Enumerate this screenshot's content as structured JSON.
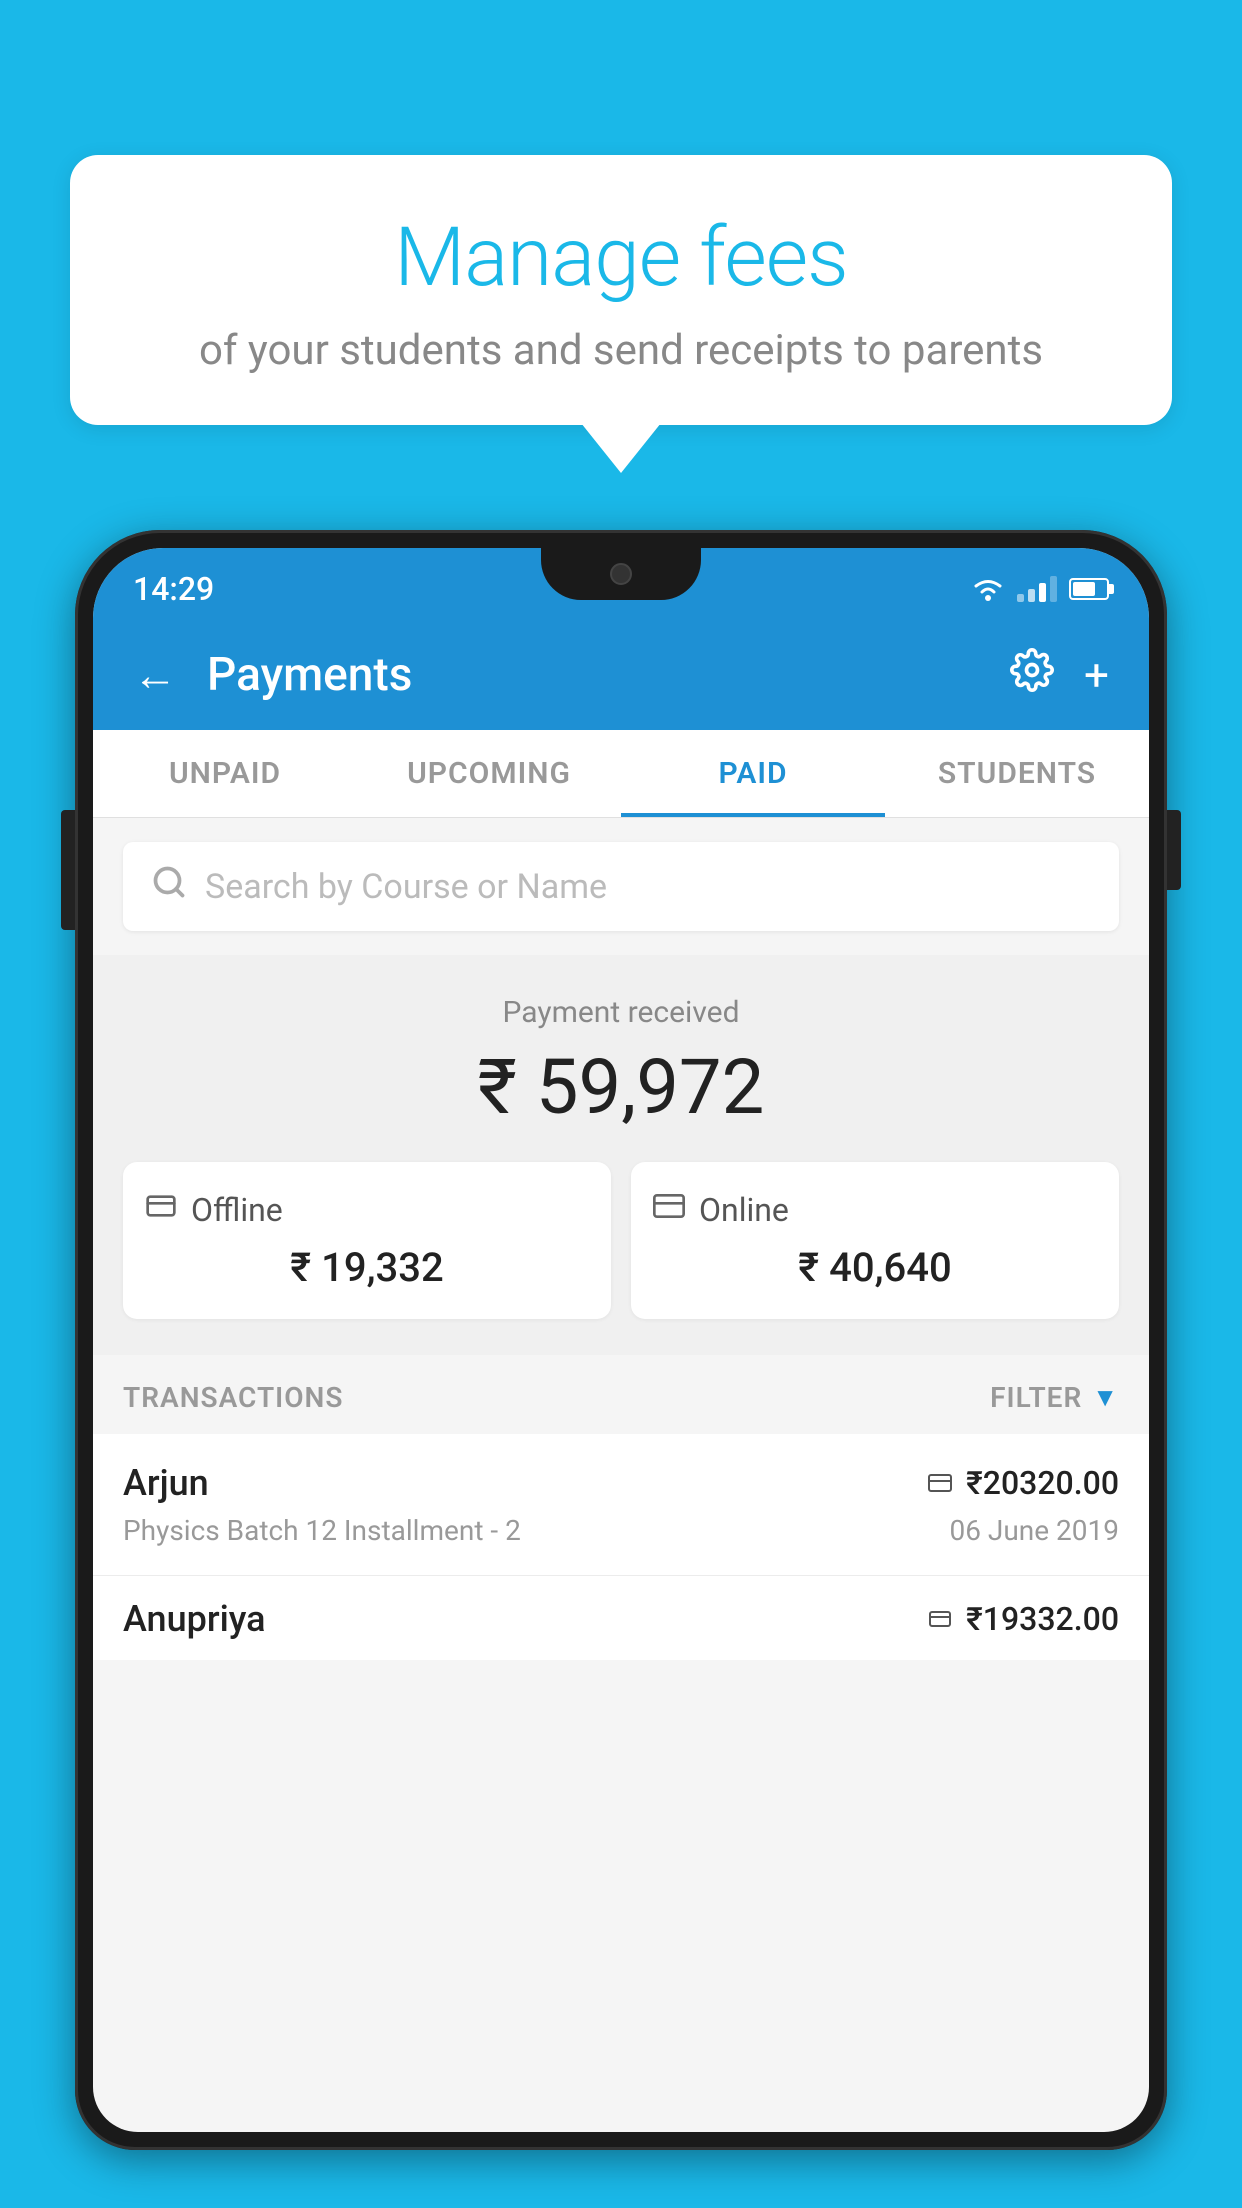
{
  "background_color": "#1ab8e8",
  "speech_bubble": {
    "title": "Manage fees",
    "subtitle": "of your students and send receipts to parents"
  },
  "status_bar": {
    "time": "14:29"
  },
  "header": {
    "title": "Payments",
    "back_label": "←",
    "settings_label": "⚙",
    "add_label": "+"
  },
  "tabs": [
    {
      "label": "UNPAID",
      "active": false
    },
    {
      "label": "UPCOMING",
      "active": false
    },
    {
      "label": "PAID",
      "active": true
    },
    {
      "label": "STUDENTS",
      "active": false
    }
  ],
  "search": {
    "placeholder": "Search by Course or Name"
  },
  "payment_summary": {
    "label": "Payment received",
    "amount": "₹ 59,972",
    "offline": {
      "label": "Offline",
      "amount": "₹ 19,332"
    },
    "online": {
      "label": "Online",
      "amount": "₹ 40,640"
    }
  },
  "transactions_section": {
    "label": "TRANSACTIONS",
    "filter_label": "FILTER"
  },
  "transactions": [
    {
      "name": "Arjun",
      "amount": "₹20320.00",
      "course": "Physics Batch 12 Installment - 2",
      "date": "06 June 2019",
      "payment_type": "online"
    },
    {
      "name": "Anupriya",
      "amount": "₹19332.00",
      "course": "",
      "date": "",
      "payment_type": "offline"
    }
  ]
}
